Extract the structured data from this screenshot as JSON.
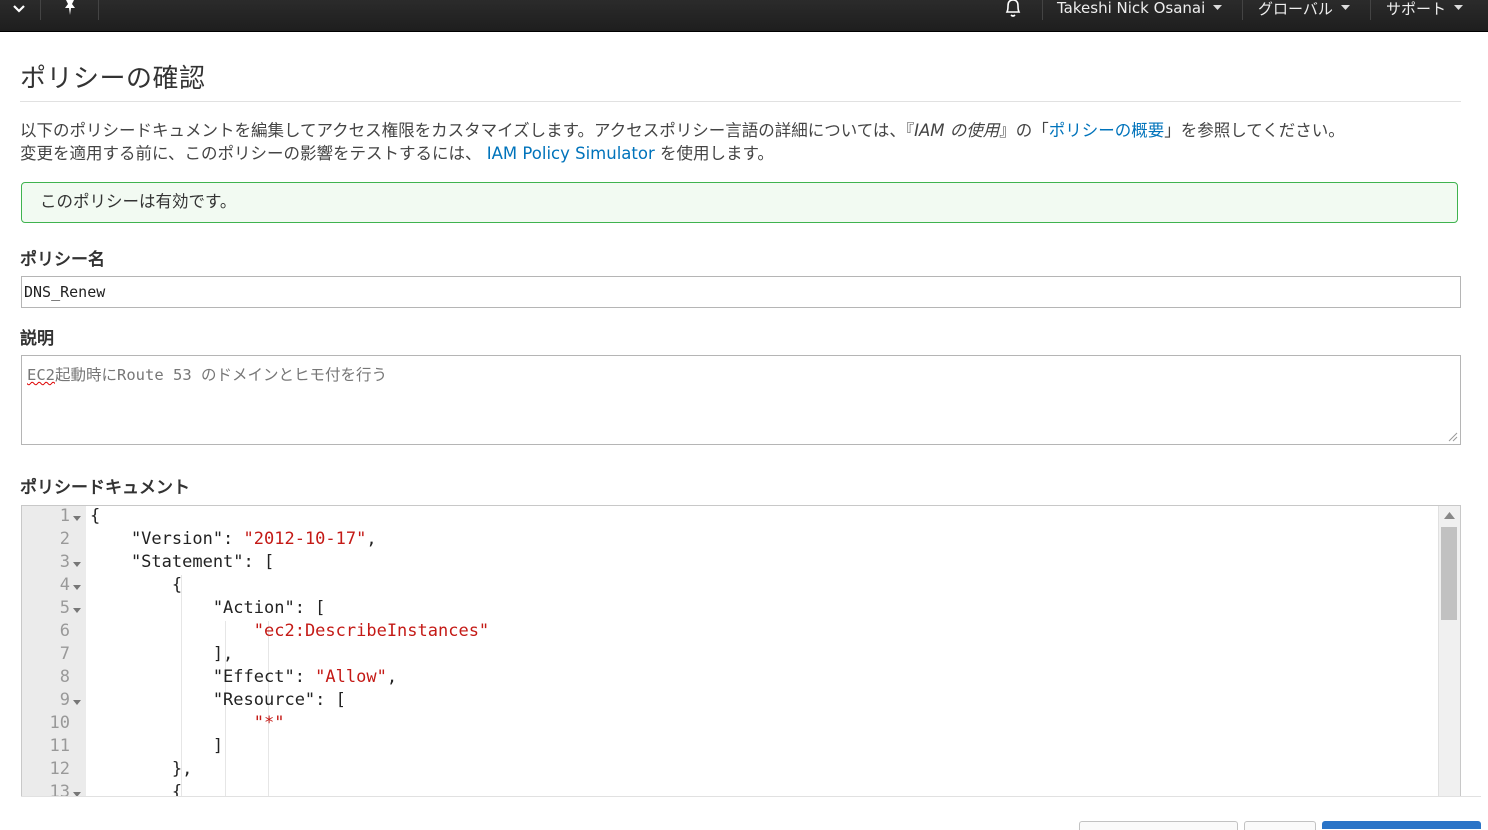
{
  "topbar": {
    "user_menu": "Takeshi Nick Osanai",
    "region_menu": "グローバル",
    "support_menu": "サポート"
  },
  "page": {
    "title": "ポリシーの確認",
    "description": {
      "part1": "以下のポリシードキュメントを編集してアクセス権限をカスタマイズします。アクセスポリシー言語の詳細については、",
      "guide_prefix": "『",
      "guide_title": "IAM の使用",
      "guide_suffix": "』の「",
      "link_overview": "ポリシーの概要",
      "part2": "」を参照してください。",
      "part3": "変更を適用する前に、このポリシーの影響をテストするには、",
      "link_simulator": "IAM Policy Simulator",
      "part4": " を使用します。"
    },
    "notice": "このポリシーは有効です。"
  },
  "form": {
    "policy_name_label": "ポリシー名",
    "policy_name_value": "DNS_Renew",
    "description_label": "説明",
    "description_misspelled": "EC2",
    "description_rest": "起動時にRoute 53 のドメインとヒモ付を行う",
    "document_label": "ポリシードキュメント"
  },
  "editor": {
    "line_numbers": [
      "1",
      "2",
      "3",
      "4",
      "5",
      "6",
      "7",
      "8",
      "9",
      "10",
      "11",
      "12",
      "13"
    ],
    "lines": [
      {
        "pre": "{",
        "str": "",
        "post": ""
      },
      {
        "pre": "    \"Version\": ",
        "str": "\"2012-10-17\"",
        "post": ","
      },
      {
        "pre": "    \"Statement\": [",
        "str": "",
        "post": ""
      },
      {
        "pre": "        {",
        "str": "",
        "post": ""
      },
      {
        "pre": "            \"Action\": [",
        "str": "",
        "post": ""
      },
      {
        "pre": "                ",
        "str": "\"ec2:DescribeInstances\"",
        "post": ""
      },
      {
        "pre": "            ],",
        "str": "",
        "post": ""
      },
      {
        "pre": "            \"Effect\": ",
        "str": "\"Allow\"",
        "post": ","
      },
      {
        "pre": "            \"Resource\": [",
        "str": "",
        "post": ""
      },
      {
        "pre": "                ",
        "str": "\"*\"",
        "post": ""
      },
      {
        "pre": "            ]",
        "str": "",
        "post": ""
      },
      {
        "pre": "        },",
        "str": "",
        "post": ""
      },
      {
        "pre": "        {",
        "str": "",
        "post": ""
      }
    ]
  },
  "colors": {
    "link": "#0073bb",
    "success_border": "#3fb34f",
    "string": "#c41a16"
  }
}
